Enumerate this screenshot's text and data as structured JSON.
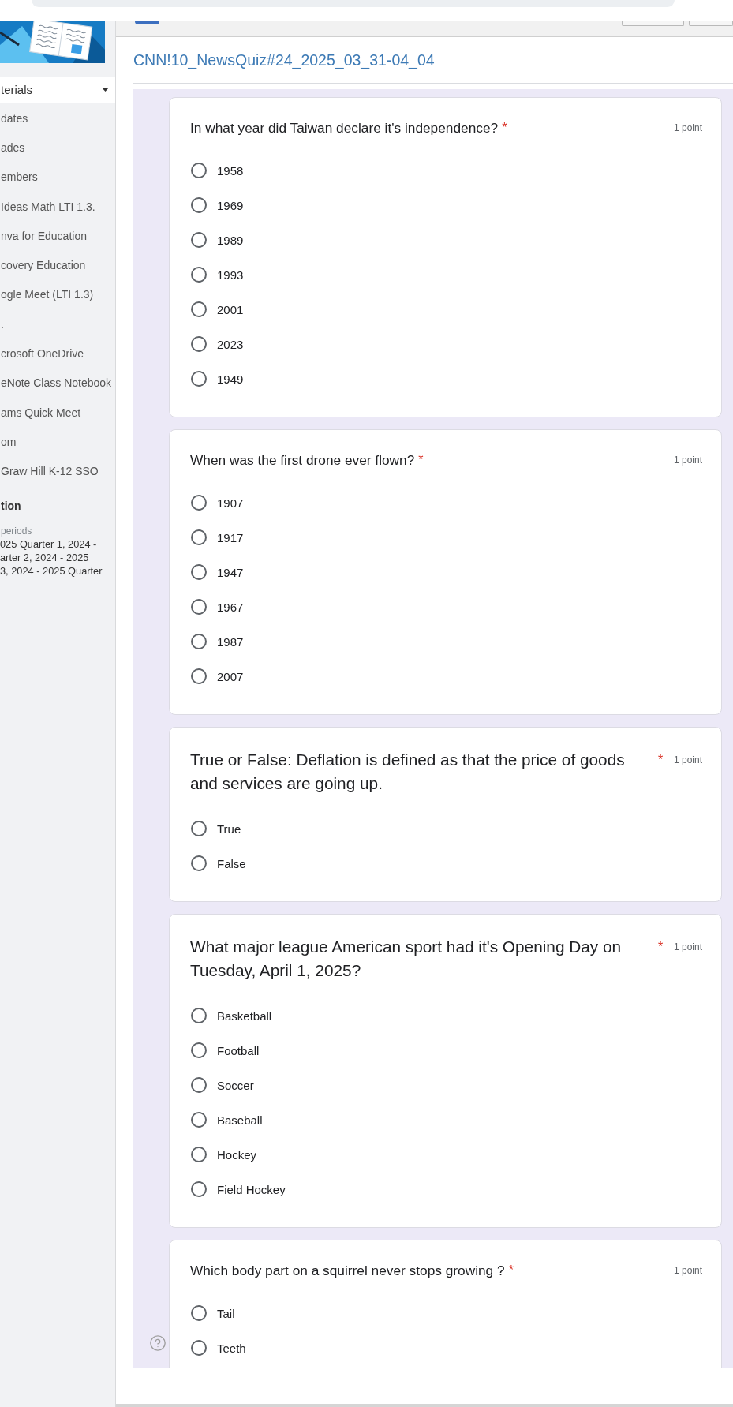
{
  "sidebar": {
    "dropdown": "terials",
    "items": [
      "dates",
      "ades",
      "embers",
      "Ideas Math LTI 1.3.",
      "nva for Education",
      "covery Education",
      "ogle Meet (LTI 1.3)",
      ".",
      "crosoft OneDrive",
      "eNote Class Notebook",
      "ams Quick Meet",
      "om",
      "Graw Hill K-12 SSO"
    ],
    "section_heading": "tion",
    "periods_label": "periods",
    "periods": [
      "025 Quarter 1, 2024 -",
      "arter 2, 2024 - 2025",
      "3, 2024 - 2025 Quarter"
    ]
  },
  "quiz": {
    "title": "CNN!10_NewsQuiz#24_2025_03_31-04_04",
    "questions": [
      {
        "kind": "normal",
        "text": "In what year did Taiwan declare it's independence?",
        "required_mark": "*",
        "points": "1 point",
        "options": [
          {
            "label": "1958",
            "selected": false
          },
          {
            "label": "1969",
            "selected": false
          },
          {
            "label": "1989",
            "selected": false
          },
          {
            "label": "1993",
            "selected": false
          },
          {
            "label": "2001",
            "selected": false
          },
          {
            "label": "2023",
            "selected": false
          },
          {
            "label": "1949",
            "selected": false
          }
        ]
      },
      {
        "kind": "normal",
        "text": "When was the first drone ever flown?",
        "required_mark": "*",
        "points": "1 point",
        "options": [
          {
            "label": "1907",
            "selected": false
          },
          {
            "label": "1917",
            "selected": false
          },
          {
            "label": "1947",
            "selected": false
          },
          {
            "label": "1967",
            "selected": false
          },
          {
            "label": "1987",
            "selected": false
          },
          {
            "label": "2007",
            "selected": false
          }
        ]
      },
      {
        "kind": "large",
        "text": "True or False: Deflation is defined as that the price of goods and services are going up.",
        "required_mark": "*",
        "points": "1 point",
        "options": [
          {
            "label": "True",
            "selected": false
          },
          {
            "label": "False",
            "selected": false
          }
        ]
      },
      {
        "kind": "large",
        "text": "What major league American sport had it's Opening Day on Tuesday, April 1, 2025?",
        "required_mark": "*",
        "points": "1 point",
        "options": [
          {
            "label": "Basketball",
            "selected": false
          },
          {
            "label": "Football",
            "selected": false
          },
          {
            "label": "Soccer",
            "selected": false
          },
          {
            "label": "Baseball",
            "selected": false
          },
          {
            "label": "Hockey",
            "selected": false
          },
          {
            "label": "Field Hockey",
            "selected": false
          }
        ]
      },
      {
        "kind": "normal",
        "text": "Which body part on a squirrel never stops growing ?",
        "required_mark": "*",
        "points": "1 point",
        "options": [
          {
            "label": "Tail",
            "selected": false
          },
          {
            "label": "Teeth",
            "selected": false
          }
        ]
      }
    ]
  }
}
